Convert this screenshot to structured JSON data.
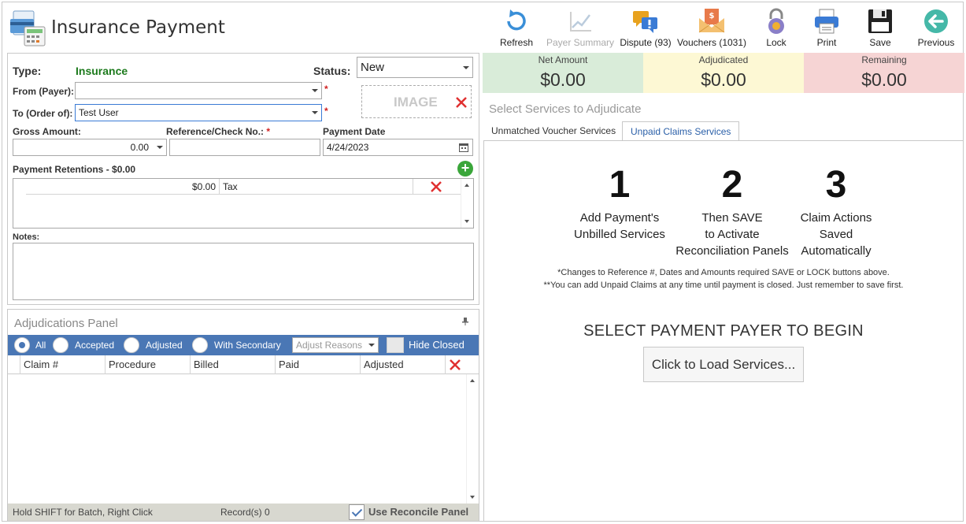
{
  "window": {
    "title": "Insurance Payment"
  },
  "toolbar": {
    "refresh": "Refresh",
    "payer_summary": "Payer Summary",
    "dispute": "Dispute (93)",
    "vouchers": "Vouchers (1031)",
    "lock": "Lock",
    "print": "Print",
    "save": "Save",
    "previous": "Previous"
  },
  "form": {
    "type_label": "Type:",
    "type_value": "Insurance",
    "status_label": "Status:",
    "status_value": "New",
    "from_label": "From (Payer):",
    "from_value": "",
    "to_label": "To (Order of):",
    "to_value": "Test User",
    "required_mark": "*",
    "image_text": "IMAGE",
    "gross_label": "Gross Amount:",
    "gross_value": "0.00",
    "ref_label": "Reference/Check No.:",
    "ref_value": "",
    "date_label": "Payment Date",
    "date_value": "4/24/2023",
    "retentions_label": "Payment Retentions - $0.00",
    "retentions": [
      {
        "amount": "$0.00",
        "description": "Tax"
      }
    ],
    "notes_label": "Notes:"
  },
  "adjudications": {
    "title": "Adjudications Panel",
    "filters": {
      "all": "All",
      "accepted": "Accepted",
      "adjusted": "Adjusted",
      "with_secondary": "With Secondary"
    },
    "adjust_reasons_placeholder": "Adjust Reasons",
    "hide_closed": "Hide Closed",
    "columns": [
      "Claim #",
      "Procedure",
      "Billed",
      "Paid",
      "Adjusted"
    ],
    "status_hint": "Hold SHIFT for Batch, Right Click",
    "records": "Record(s) 0",
    "use_reconcile": "Use Reconcile Panel"
  },
  "summary": {
    "net_label": "Net Amount",
    "net_value": "$0.00",
    "adj_label": "Adjudicated",
    "adj_value": "$0.00",
    "rem_label": "Remaining",
    "rem_value": "$0.00"
  },
  "services": {
    "title": "Select Services to Adjudicate",
    "tabs": [
      "Unmatched Voucher Services",
      "Unpaid Claims Services"
    ],
    "steps": [
      {
        "num": "1",
        "line1": "Add Payment's",
        "line2": "Unbilled Services",
        "line3": ""
      },
      {
        "num": "2",
        "line1": "Then SAVE",
        "line2": "to Activate",
        "line3": "Reconciliation Panels"
      },
      {
        "num": "3",
        "line1": "Claim Actions",
        "line2": "Saved",
        "line3": "Automatically"
      }
    ],
    "note1": "*Changes to Reference #, Dates and Amounts required SAVE or LOCK buttons above.",
    "note2": "**You can add Unpaid Claims at any time until payment is closed. Just remember to save first.",
    "begin": "SELECT PAYMENT PAYER TO BEGIN",
    "load_button": "Click to Load Services..."
  },
  "colors": {
    "net_bg": "#d9ecd9",
    "adj_bg": "#fdf8d4",
    "rem_bg": "#f6d4d4",
    "accent": "#4a77b5",
    "type_green": "#1c7a1c",
    "delete_red": "#e03030"
  }
}
